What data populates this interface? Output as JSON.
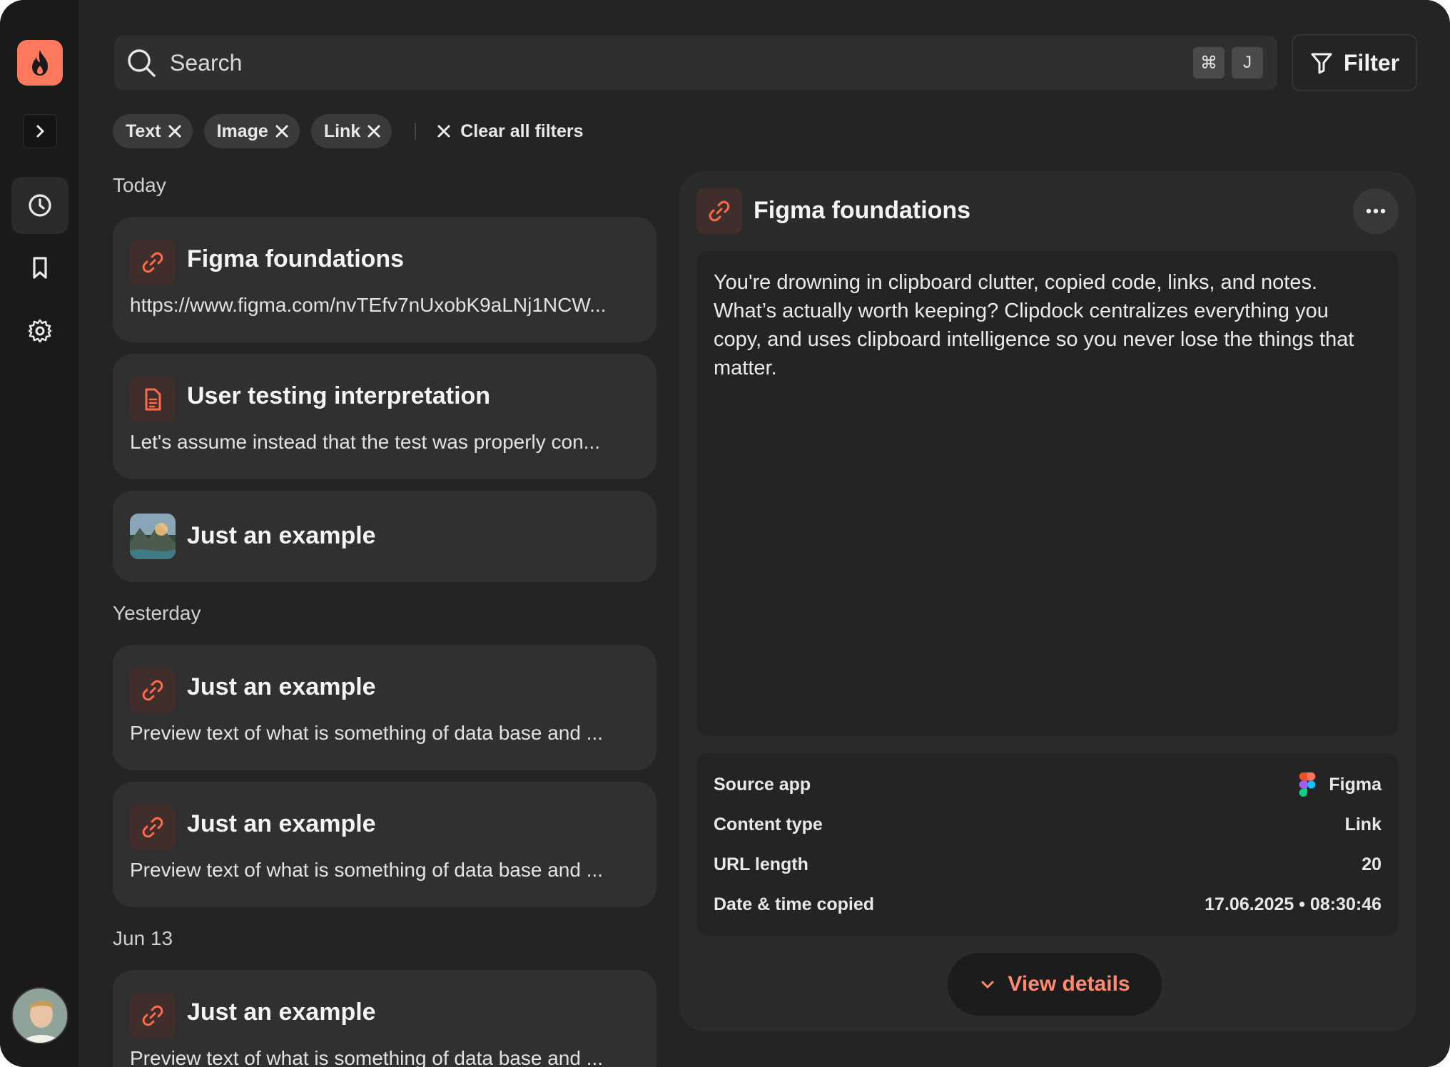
{
  "app": {
    "brand_color": "#ff7a5c",
    "accent_color": "#ff6a4a"
  },
  "sidebar": {
    "logo_icon": "flame-icon",
    "expand_icon": "chevron-right-icon",
    "items": [
      {
        "icon": "clock-icon",
        "active": true
      },
      {
        "icon": "bookmark-icon",
        "active": false
      },
      {
        "icon": "gear-icon",
        "active": false
      }
    ]
  },
  "search": {
    "label": "Search",
    "shortcut_keys": [
      "⌘",
      "J"
    ]
  },
  "filter_button": {
    "label": "Filter"
  },
  "active_filters": [
    {
      "label": "Text"
    },
    {
      "label": "Image"
    },
    {
      "label": "Link"
    }
  ],
  "clear_filters_label": "Clear all filters",
  "groups": [
    {
      "label": "Today",
      "items": [
        {
          "type": "link",
          "title": "Figma foundations",
          "preview": "https://www.figma.com/nvTEfv7nUxobK9aLNj1NCW..."
        },
        {
          "type": "text",
          "title": "User testing interpretation",
          "preview": "Let's assume instead that the test was properly con..."
        },
        {
          "type": "image",
          "title": "Just an example",
          "preview": ""
        }
      ]
    },
    {
      "label": "Yesterday",
      "items": [
        {
          "type": "link",
          "title": "Just an example",
          "preview": "Preview text of what is something of data base and ..."
        },
        {
          "type": "link",
          "title": "Just an example",
          "preview": "Preview text of what is something of data base and ..."
        }
      ]
    },
    {
      "label": "Jun 13",
      "items": [
        {
          "type": "link",
          "title": "Just an example",
          "preview": "Preview text of what is something of data base and ..."
        }
      ]
    }
  ],
  "detail": {
    "title": "Figma foundations",
    "type_icon": "link-icon",
    "content": "You're drowning in clipboard clutter, copied code, links, and notes. What’s actually worth keeping? Clipdock centralizes everything you copy, and uses clipboard intelligence so you never lose the things that matter.",
    "meta": [
      {
        "label": "Source app",
        "value": "Figma",
        "icon": "figma-icon"
      },
      {
        "label": "Content type",
        "value": "Link"
      },
      {
        "label": "URL length",
        "value": "20"
      },
      {
        "label": "Date & time copied",
        "value": "17.06.2025 • 08:30:46"
      }
    ],
    "view_details_label": "View details"
  }
}
